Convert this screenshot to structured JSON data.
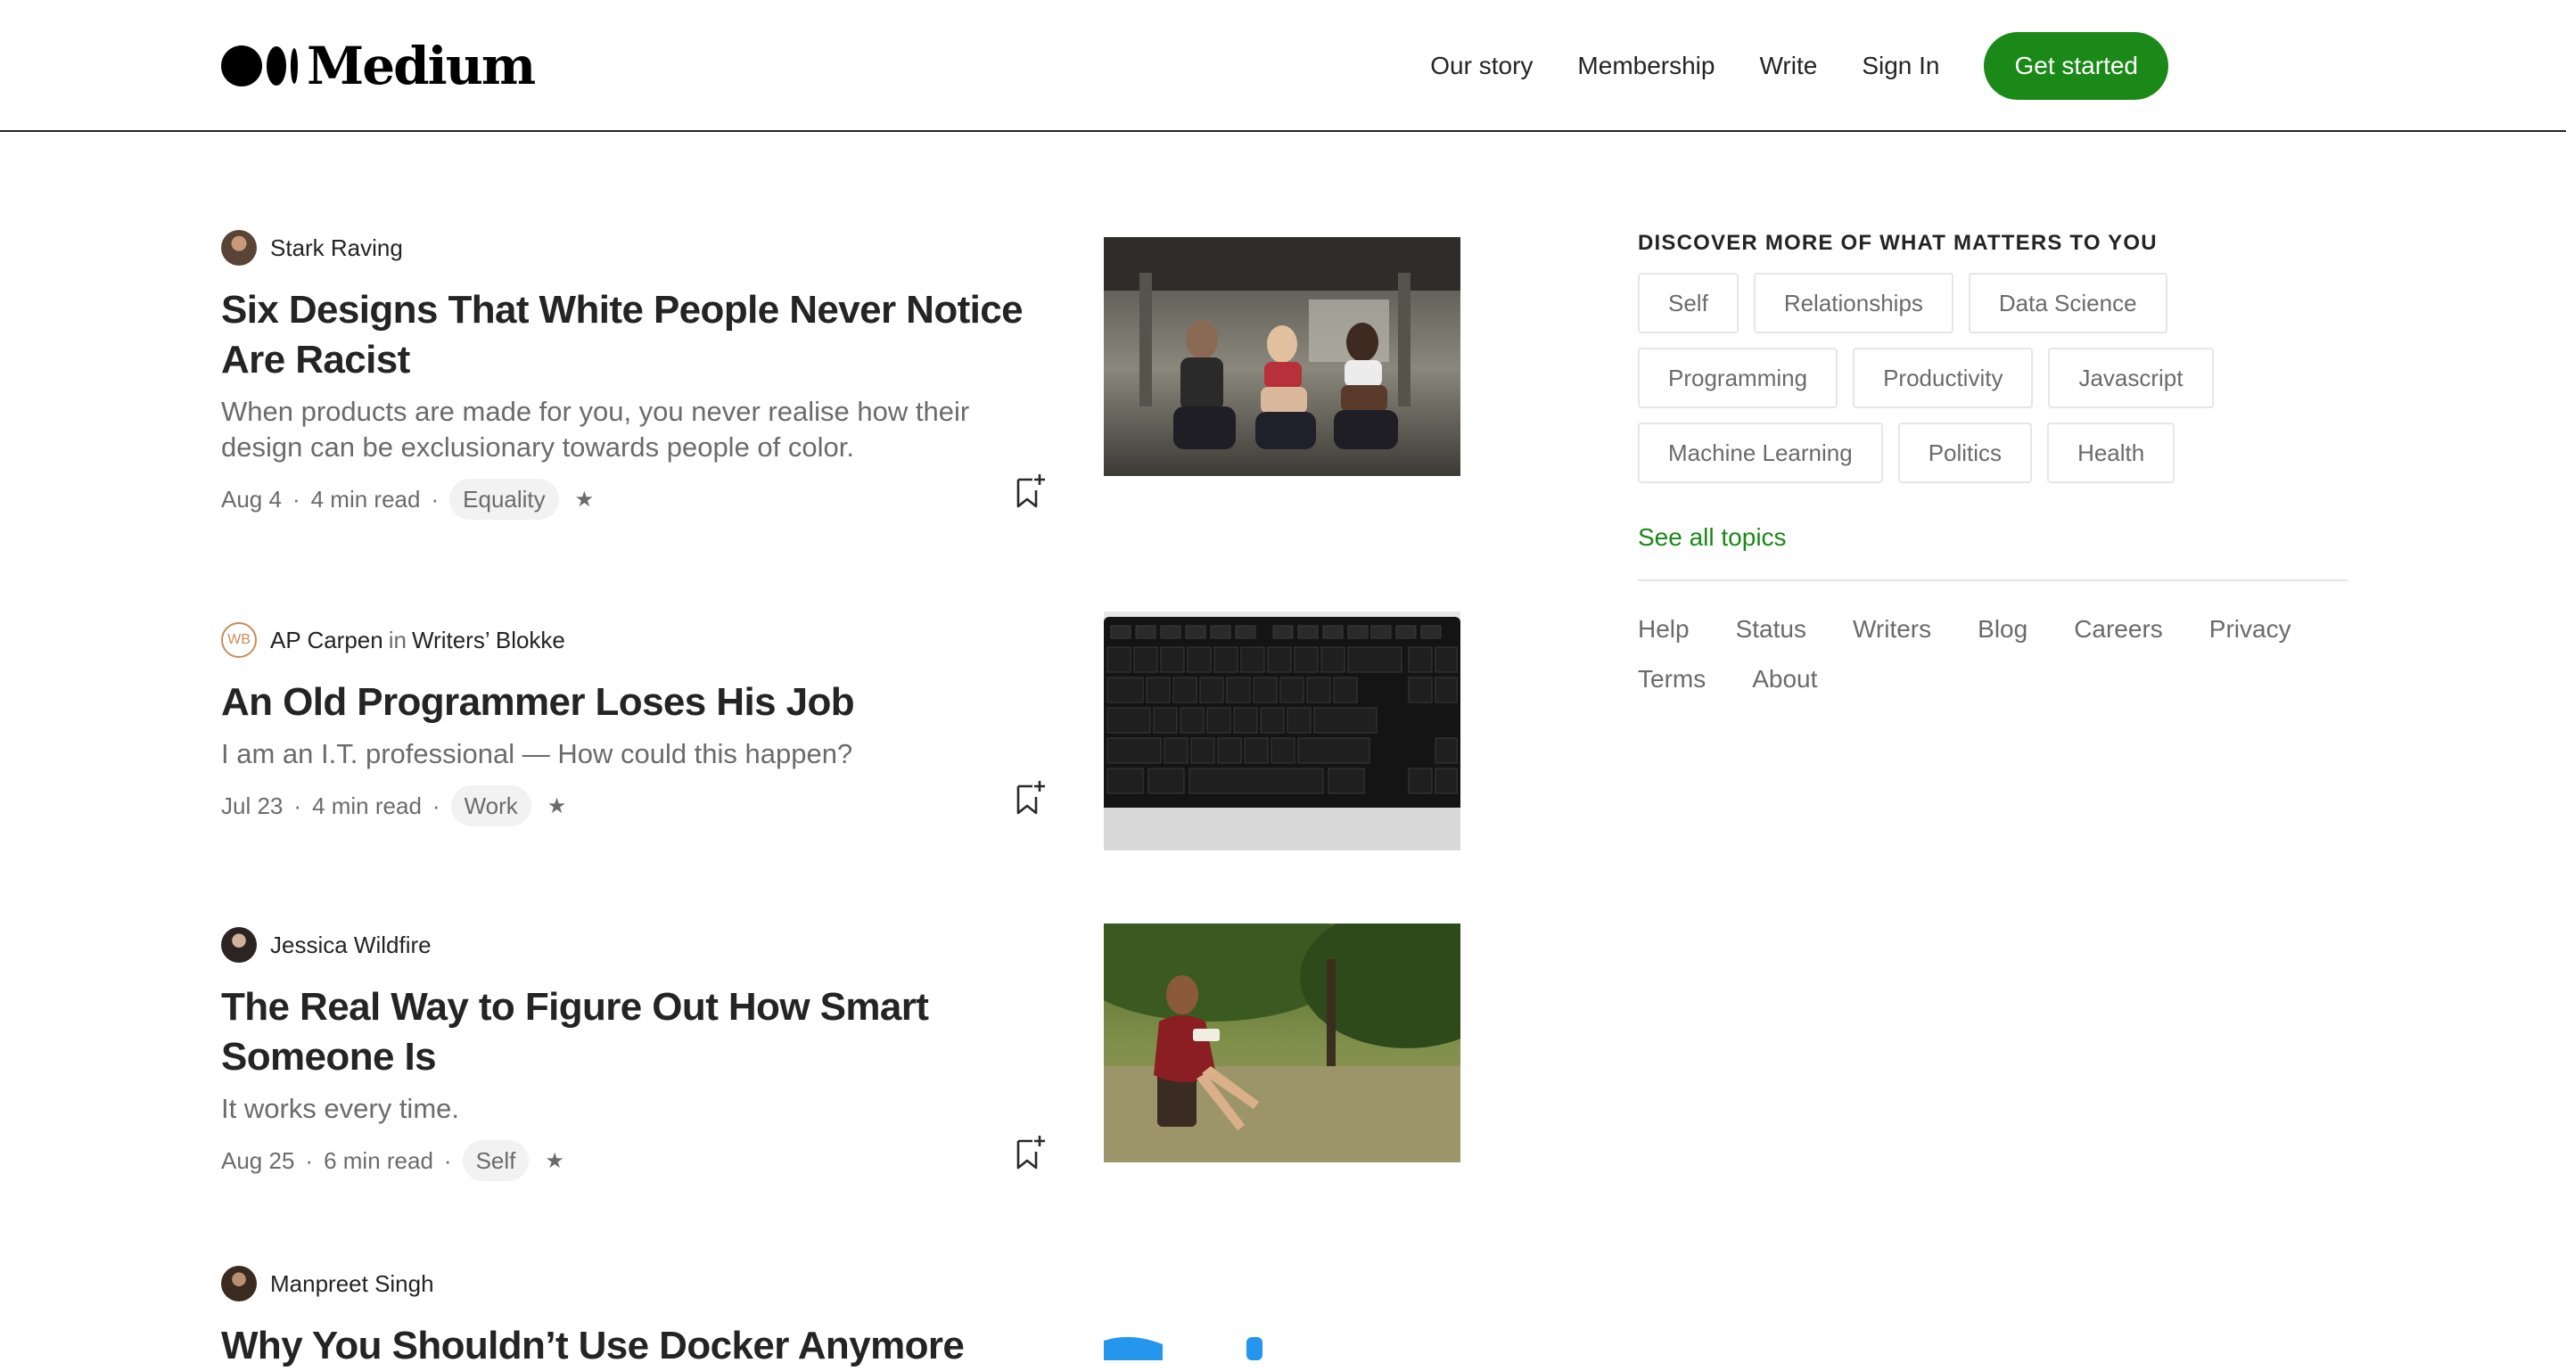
{
  "header": {
    "logo_text": "Medium",
    "nav": [
      "Our story",
      "Membership",
      "Write",
      "Sign In"
    ],
    "cta": "Get started",
    "accent_color": "#1a8917"
  },
  "posts": [
    {
      "author": "Stark Raving",
      "publication_prefix": "",
      "publication": "",
      "title": "Six Designs That White People Never Notice Are Racist",
      "subtitle": "When products are made for you, you never realise how their design can be exclusionary towards people of color.",
      "date": "Aug 4",
      "read_time": "4 min read",
      "tag": "Equality",
      "image": "three women sitting on gym floor"
    },
    {
      "author": "AP Carpen",
      "avatar_text": "WB",
      "publication_prefix": "in",
      "publication": "Writers’ Blokke",
      "title": "An Old Programmer Loses His Job",
      "subtitle": "I am an I.T. professional — How could this happen?",
      "date": "Jul 23",
      "read_time": "4 min read",
      "tag": "Work",
      "image": "black computer keyboard"
    },
    {
      "author": "Jessica Wildfire",
      "publication_prefix": "",
      "publication": "",
      "title": "The Real Way to Figure Out How Smart Someone Is",
      "subtitle": "It works every time.",
      "date": "Aug 25",
      "read_time": "6 min read",
      "tag": "Self",
      "image": "woman in red dress reading on tree stump"
    },
    {
      "author": "Manpreet Singh",
      "publication_prefix": "",
      "publication": "",
      "title": "Why You Shouldn’t Use Docker Anymore",
      "image": "docker logo partially visible"
    }
  ],
  "sidebar": {
    "heading": "DISCOVER MORE OF WHAT MATTERS TO YOU",
    "topics": [
      "Self",
      "Relationships",
      "Data Science",
      "Programming",
      "Productivity",
      "Javascript",
      "Machine Learning",
      "Politics",
      "Health"
    ],
    "see_all": "See all topics",
    "footer_links": [
      "Help",
      "Status",
      "Writers",
      "Blog",
      "Careers",
      "Privacy",
      "Terms",
      "About"
    ]
  }
}
